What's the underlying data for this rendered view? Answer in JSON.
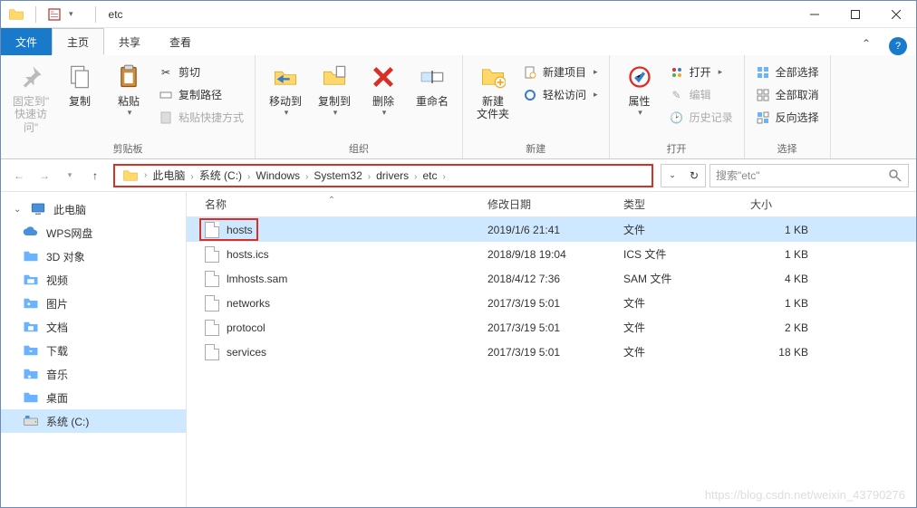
{
  "title": "etc",
  "tabs": {
    "file": "文件",
    "home": "主页",
    "share": "共享",
    "view": "查看"
  },
  "ribbon": {
    "clipboard": {
      "pin": "固定到\"\n快速访问\"",
      "copy": "复制",
      "paste": "粘贴",
      "cut": "剪切",
      "copy_path": "复制路径",
      "paste_shortcut": "粘贴快捷方式",
      "label": "剪贴板"
    },
    "organize": {
      "move_to": "移动到",
      "copy_to": "复制到",
      "delete": "删除",
      "rename": "重命名",
      "label": "组织"
    },
    "new_group": {
      "new_folder": "新建\n文件夹",
      "new_item": "新建项目",
      "easy_access": "轻松访问",
      "label": "新建"
    },
    "open_group": {
      "properties": "属性",
      "open": "打开",
      "edit": "编辑",
      "history": "历史记录",
      "label": "打开"
    },
    "select_group": {
      "select_all": "全部选择",
      "select_none": "全部取消",
      "invert": "反向选择",
      "label": "选择"
    }
  },
  "breadcrumb": [
    "此电脑",
    "系统 (C:)",
    "Windows",
    "System32",
    "drivers",
    "etc"
  ],
  "search_placeholder": "搜索\"etc\"",
  "columns": {
    "name": "名称",
    "date": "修改日期",
    "type": "类型",
    "size": "大小"
  },
  "tree": {
    "this_pc": "此电脑",
    "items": [
      {
        "label": "WPS网盘",
        "icon": "cloud"
      },
      {
        "label": "3D 对象",
        "icon": "folder3d"
      },
      {
        "label": "视频",
        "icon": "video"
      },
      {
        "label": "图片",
        "icon": "pictures"
      },
      {
        "label": "文档",
        "icon": "docs"
      },
      {
        "label": "下载",
        "icon": "downloads"
      },
      {
        "label": "音乐",
        "icon": "music"
      },
      {
        "label": "桌面",
        "icon": "desktop"
      }
    ],
    "system_drive": "系统 (C:)"
  },
  "files": [
    {
      "name": "hosts",
      "date": "2019/1/6 21:41",
      "type": "文件",
      "size": "1 KB",
      "selected": true,
      "highlight": true
    },
    {
      "name": "hosts.ics",
      "date": "2018/9/18 19:04",
      "type": "ICS 文件",
      "size": "1 KB"
    },
    {
      "name": "lmhosts.sam",
      "date": "2018/4/12 7:36",
      "type": "SAM 文件",
      "size": "4 KB"
    },
    {
      "name": "networks",
      "date": "2017/3/19 5:01",
      "type": "文件",
      "size": "1 KB"
    },
    {
      "name": "protocol",
      "date": "2017/3/19 5:01",
      "type": "文件",
      "size": "2 KB"
    },
    {
      "name": "services",
      "date": "2017/3/19 5:01",
      "type": "文件",
      "size": "18 KB"
    }
  ],
  "watermark": "https://blog.csdn.net/weixin_43790276"
}
